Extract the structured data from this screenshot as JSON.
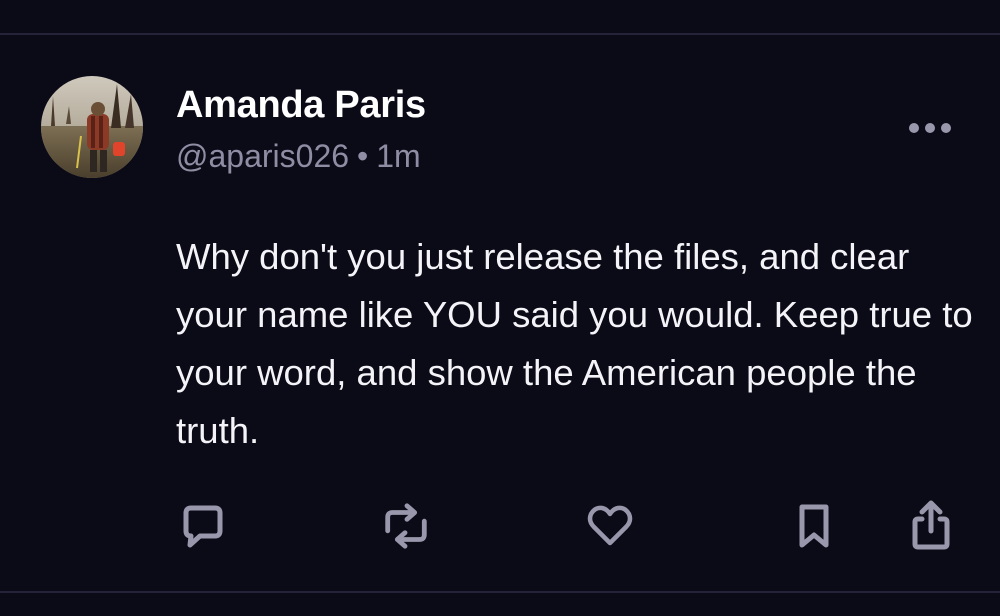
{
  "post": {
    "author": {
      "display_name": "Amanda Paris",
      "handle": "@aparis026",
      "separator": "•",
      "timestamp": "1m"
    },
    "text": "Why don't you just release the files, and clear your name like YOU said you would. Keep true to your word, and show the American people the truth.",
    "actions": [
      {
        "name": "reply",
        "icon": "chat-bubble-icon"
      },
      {
        "name": "repost",
        "icon": "repost-arrows-icon"
      },
      {
        "name": "like",
        "icon": "heart-icon"
      },
      {
        "name": "bookmark",
        "icon": "bookmark-icon"
      },
      {
        "name": "share",
        "icon": "share-upload-icon"
      }
    ]
  },
  "colors": {
    "background": "#0b0a17",
    "divider": "#24233a",
    "primary_text": "#ffffff",
    "secondary_text": "#8f8da3",
    "icon": "#9997ab"
  }
}
